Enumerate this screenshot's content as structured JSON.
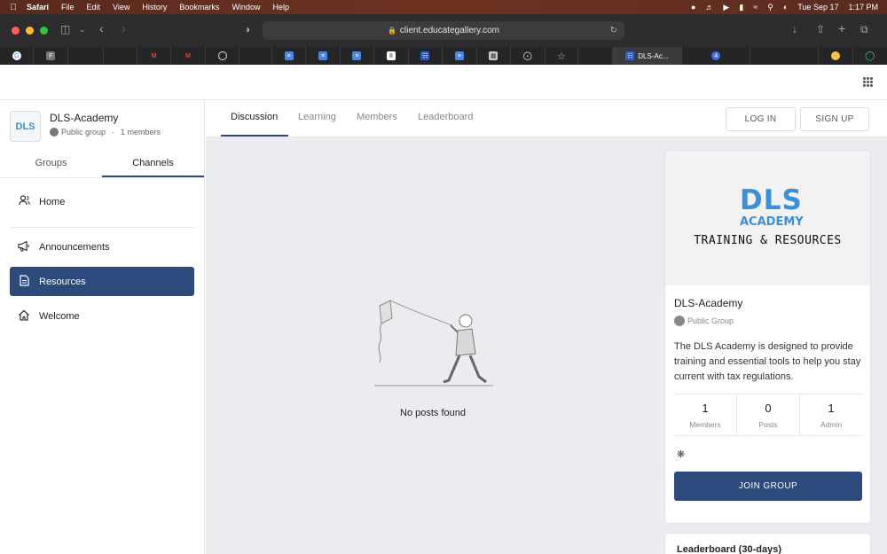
{
  "menubar": {
    "app": "Safari",
    "items": [
      "File",
      "Edit",
      "View",
      "History",
      "Bookmarks",
      "Window",
      "Help"
    ],
    "date": "Tue Sep 17",
    "time": "1:17 PM"
  },
  "browser": {
    "url": "client.educategallery.com",
    "active_tab_title": "DLS-Ac...",
    "tab_badge": "4"
  },
  "group": {
    "name": "DLS-Academy",
    "logo_text": "DLS",
    "visibility": "Public group",
    "separator": "·",
    "members_text": "1 members"
  },
  "sidebar": {
    "tabs": [
      "Groups",
      "Channels"
    ],
    "active_tab": "Channels",
    "items": [
      {
        "label": "Home",
        "icon": "users-icon"
      },
      {
        "label": "Announcements",
        "icon": "megaphone-icon"
      },
      {
        "label": "Resources",
        "icon": "document-icon"
      },
      {
        "label": "Welcome",
        "icon": "home-icon"
      }
    ],
    "active_item": "Resources"
  },
  "main": {
    "tabs": [
      "Discussion",
      "Learning",
      "Members",
      "Leaderboard"
    ],
    "active_tab": "Discussion",
    "login_label": "LOG IN",
    "signup_label": "SIGN UP",
    "empty_message": "No posts found"
  },
  "card": {
    "logo_big": "DLS",
    "logo_small": "ACADEMY",
    "logo_sub": "TRAINING & RESOURCES",
    "title": "DLS-Academy",
    "visibility": "Public Group",
    "description": "The DLS Academy is designed to provide training and essential tools to help you stay current with tax regulations.",
    "stats": [
      {
        "value": "1",
        "label": "Members"
      },
      {
        "value": "0",
        "label": "Posts"
      },
      {
        "value": "1",
        "label": "Admin"
      }
    ],
    "join_label": "JOIN GROUP"
  },
  "leaderboard": {
    "title": "Leaderboard (30-days)"
  },
  "colors": {
    "accent": "#2c4a7c",
    "logo_blue": "#3d8fd8",
    "content_bg": "#ebecef"
  }
}
